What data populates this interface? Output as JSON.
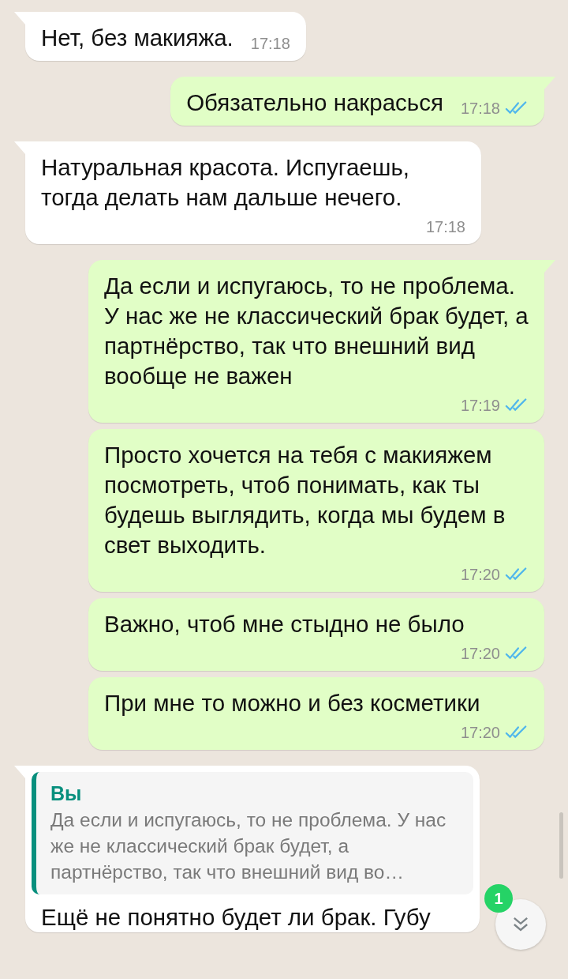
{
  "messages": [
    {
      "kind": "in",
      "text": "Нет, без макияжа.",
      "time": "17:18"
    },
    {
      "kind": "out",
      "text": "Обязательно накрасься",
      "time": "17:18",
      "read": true
    },
    {
      "kind": "in",
      "text": "Натуральная красота. Испугаешь, тогда делать нам дальше нечего.",
      "time": "17:18"
    },
    {
      "kind": "out",
      "text": "Да если и испугаюсь, то не проблема. У нас же не классический брак будет, а партнёрство, так что внешний вид вообще не важен",
      "time": "17:19",
      "read": true
    },
    {
      "kind": "out",
      "text": "Просто хочется на тебя с макияжем посмотреть, чтоб понимать, как ты будешь выглядить, когда мы будем в свет выходить.",
      "time": "17:20",
      "read": true
    },
    {
      "kind": "out",
      "text": "Важно, чтоб мне стыдно не было",
      "time": "17:20",
      "read": true
    },
    {
      "kind": "out",
      "text": "При мне то можно и без косметики",
      "time": "17:20",
      "read": true
    },
    {
      "kind": "in",
      "quote": {
        "author": "Вы",
        "text": "Да если и испугаюсь, то не проблема. У нас же не классический брак будет, а партнёрство, так что внешний вид во…"
      },
      "text": "Ещё не понятно будет ли брак. Губу"
    }
  ],
  "scroll_button": {
    "badge": "1"
  }
}
